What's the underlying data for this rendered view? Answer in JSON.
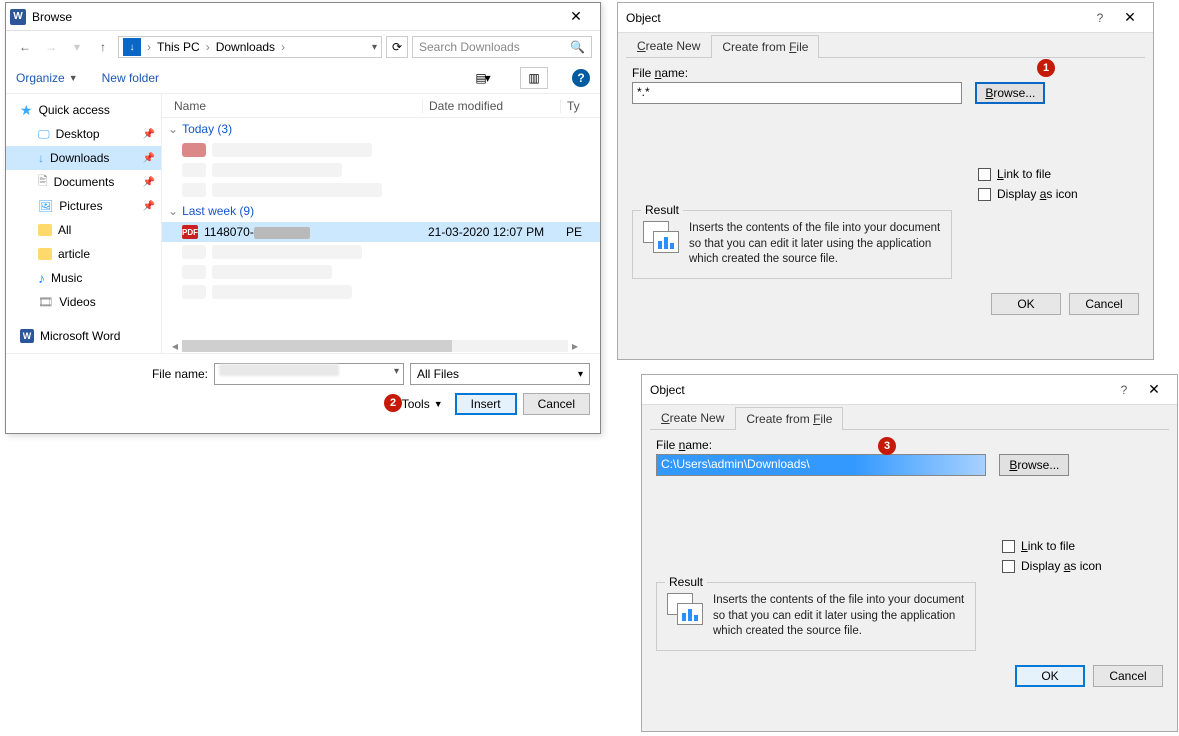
{
  "browse": {
    "title": "Browse",
    "crumb1": "This PC",
    "crumb2": "Downloads",
    "search_placeholder": "Search Downloads",
    "organize": "Organize",
    "new_folder": "New folder",
    "sidebar": {
      "quick_access": "Quick access",
      "desktop": "Desktop",
      "downloads": "Downloads",
      "documents": "Documents",
      "pictures": "Pictures",
      "all": "All",
      "article": "article",
      "music": "Music",
      "videos": "Videos",
      "word": "Microsoft Word"
    },
    "cols": {
      "name": "Name",
      "date": "Date modified",
      "type": "Ty"
    },
    "group_today": "Today (3)",
    "group_lastweek": "Last week (9)",
    "sel_file_name": "1148070-",
    "sel_file_date": "21-03-2020 12:07 PM",
    "sel_file_type": "PE",
    "file_name_label": "File name:",
    "filetype": "All Files",
    "tools": "Tools",
    "insert": "Insert",
    "cancel": "Cancel"
  },
  "obj": {
    "title": "Object",
    "tab_new": "Create New",
    "tab_file_pre": "Create from ",
    "tab_file_u": "F",
    "tab_file_post": "ile",
    "file_name_label_pre": "File ",
    "file_name_label_u": "n",
    "file_name_label_post": "ame:",
    "fn1": "*.*",
    "fn2": "C:\\Users\\admin\\Downloads\\",
    "browse_u": "B",
    "browse_post": "rowse...",
    "link_u": "L",
    "link_post": "ink to file",
    "disp_pre": "Display ",
    "disp_u": "a",
    "disp_post": "s icon",
    "result": "Result",
    "result_text": "Inserts the contents of the file into your document so that you can edit it later using the application which created the source file.",
    "ok": "OK",
    "cancel": "Cancel"
  },
  "markers": {
    "m1": "1",
    "m2": "2",
    "m3": "3"
  }
}
